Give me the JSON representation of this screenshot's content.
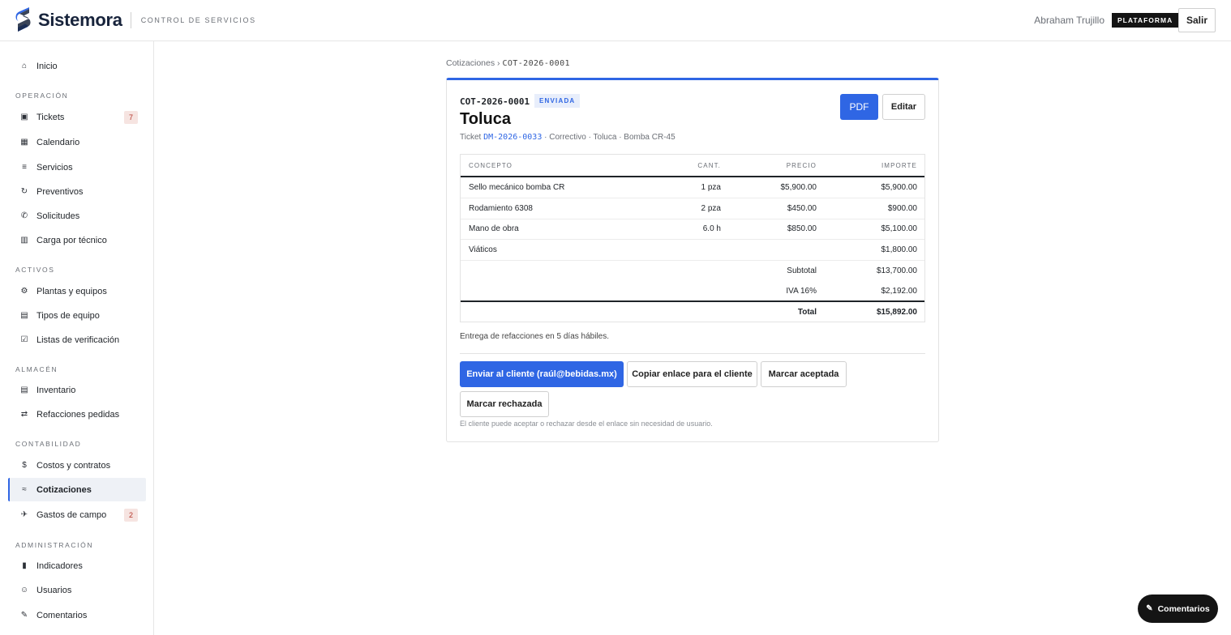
{
  "header": {
    "brand": "Sistemora",
    "subtitle": "CONTROL DE SERVICIOS",
    "user": "Abraham Trujillo",
    "badge": "PLATAFORMA",
    "logout": "Salir",
    "brand_color": "#17233b"
  },
  "sidebar": {
    "home": {
      "label": "Inicio",
      "icon": "home-icon"
    },
    "sections": {
      "operacion": "OPERACIÓN",
      "activos": "ACTIVOS",
      "almacen": "ALMACÉN",
      "contabilidad": "CONTABILIDAD",
      "administracion": "ADMINISTRACIÓN"
    },
    "items": {
      "tickets": {
        "label": "Tickets",
        "count": "7",
        "icon": "ticket-icon"
      },
      "calendario": {
        "label": "Calendario",
        "icon": "calendar-icon"
      },
      "servicios": {
        "label": "Servicios",
        "icon": "list-icon"
      },
      "preventivos": {
        "label": "Preventivos",
        "icon": "refresh-icon"
      },
      "solicitudes": {
        "label": "Solicitudes",
        "icon": "phone-icon"
      },
      "carga": {
        "label": "Carga por técnico",
        "icon": "bars-icon"
      },
      "plantas": {
        "label": "Plantas y equipos",
        "icon": "gear-icon"
      },
      "tipos": {
        "label": "Tipos de equipo",
        "icon": "grid-icon"
      },
      "listas": {
        "label": "Listas de verificación",
        "icon": "checkbox-icon"
      },
      "inventario": {
        "label": "Inventario",
        "icon": "box-icon"
      },
      "refacciones": {
        "label": "Refacciones pedidas",
        "icon": "swap-icon"
      },
      "costos": {
        "label": "Costos y contratos",
        "icon": "dollar-icon"
      },
      "cotizaciones": {
        "label": "Cotizaciones",
        "icon": "quote-icon"
      },
      "gastos": {
        "label": "Gastos de campo",
        "count": "2",
        "icon": "plane-icon"
      },
      "indicadores": {
        "label": "Indicadores",
        "icon": "chart-icon"
      },
      "usuarios": {
        "label": "Usuarios",
        "icon": "user-icon"
      },
      "comentarios": {
        "label": "Comentarios",
        "icon": "pencil-icon"
      }
    },
    "active": "cotizaciones"
  },
  "breadcrumb": {
    "parent": "Cotizaciones",
    "separator": "›",
    "current": "COT-2026-0001"
  },
  "quote": {
    "code": "COT-2026-0001",
    "status": "ENVIADA",
    "title": "Toluca",
    "meta_prefix": "Ticket",
    "ticket": "DM-2026-0033",
    "meta_rest": "· Correctivo · Toluca · Bomba CR-45",
    "pdf": "PDF",
    "edit": "Editar",
    "columns": [
      "CONCEPTO",
      "CANT.",
      "PRECIO",
      "IMPORTE"
    ],
    "rows": [
      {
        "concepto": "Sello mecánico bomba CR",
        "cant": "1 pza",
        "precio": "$5,900.00",
        "importe": "$5,900.00"
      },
      {
        "concepto": "Rodamiento 6308",
        "cant": "2 pza",
        "precio": "$450.00",
        "importe": "$900.00"
      },
      {
        "concepto": "Mano de obra",
        "cant": "6.0 h",
        "precio": "$850.00",
        "importe": "$5,100.00"
      },
      {
        "concepto": "Viáticos",
        "cant": "",
        "precio": "",
        "importe": "$1,800.00"
      }
    ],
    "subtotal_label": "Subtotal",
    "subtotal": "$13,700.00",
    "iva_label": "IVA 16%",
    "iva": "$2,192.00",
    "total_label": "Total",
    "total": "$15,892.00",
    "note": "Entrega de refacciones en 5 días hábiles.",
    "actions": {
      "send": "Enviar al cliente (raúl@bebidas.mx)",
      "copy": "Copiar enlace para el cliente",
      "accept": "Marcar aceptada",
      "reject": "Marcar rechazada"
    },
    "hint": "El cliente puede aceptar o rechazar desde el enlace sin necesidad de usuario.",
    "accent_color": "#2f66e4"
  },
  "fab": {
    "label": "Comentarios",
    "icon": "pencil-icon"
  }
}
